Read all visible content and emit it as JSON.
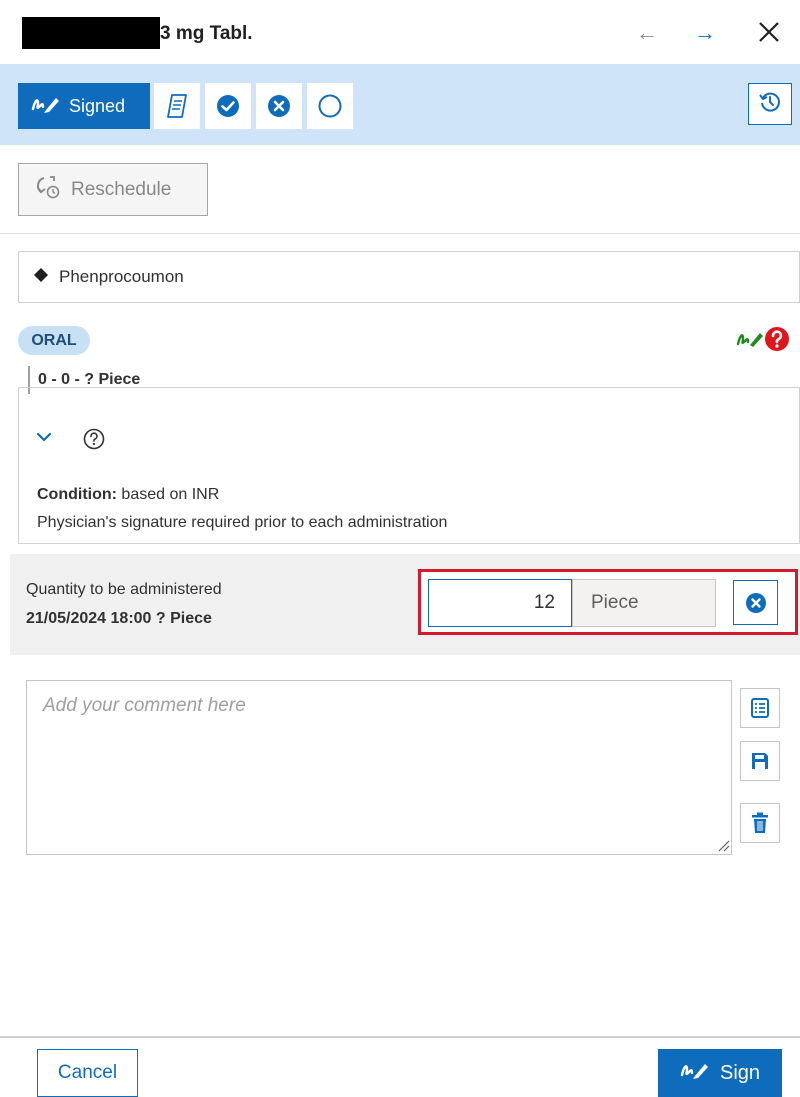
{
  "header": {
    "title_suffix": "3 mg Tabl.",
    "back_icon": "arrow-left-icon",
    "forward_icon": "arrow-right-icon",
    "close_icon": "close-icon"
  },
  "toolbar": {
    "signed_label": "Signed",
    "status_buttons": [
      "document-icon",
      "check-circle-icon",
      "cancel-circle-icon",
      "empty-circle-icon"
    ],
    "history_icon": "history-icon"
  },
  "reschedule": {
    "label": "Reschedule"
  },
  "drug": {
    "name": "Phenprocoumon"
  },
  "route": {
    "label": "ORAL"
  },
  "dose": {
    "schedule": "0 - 0 - ? Piece"
  },
  "condition": {
    "label": "Condition:",
    "value": "based on INR",
    "requirement": "Physician's signature required prior to each administration"
  },
  "quantity": {
    "label": "Quantity to be administered",
    "datetime_line": "21/05/2024 18:00 ? Piece",
    "value": "12",
    "unit": "Piece"
  },
  "comment": {
    "placeholder": "Add your comment here"
  },
  "footer": {
    "cancel_label": "Cancel",
    "sign_label": "Sign"
  },
  "colors": {
    "accent": "#0f6cbd",
    "toolbar_bg": "#cfe4f9",
    "highlight": "#d31b2f",
    "warning": "#e0161d",
    "signature": "#1f8a1f"
  }
}
